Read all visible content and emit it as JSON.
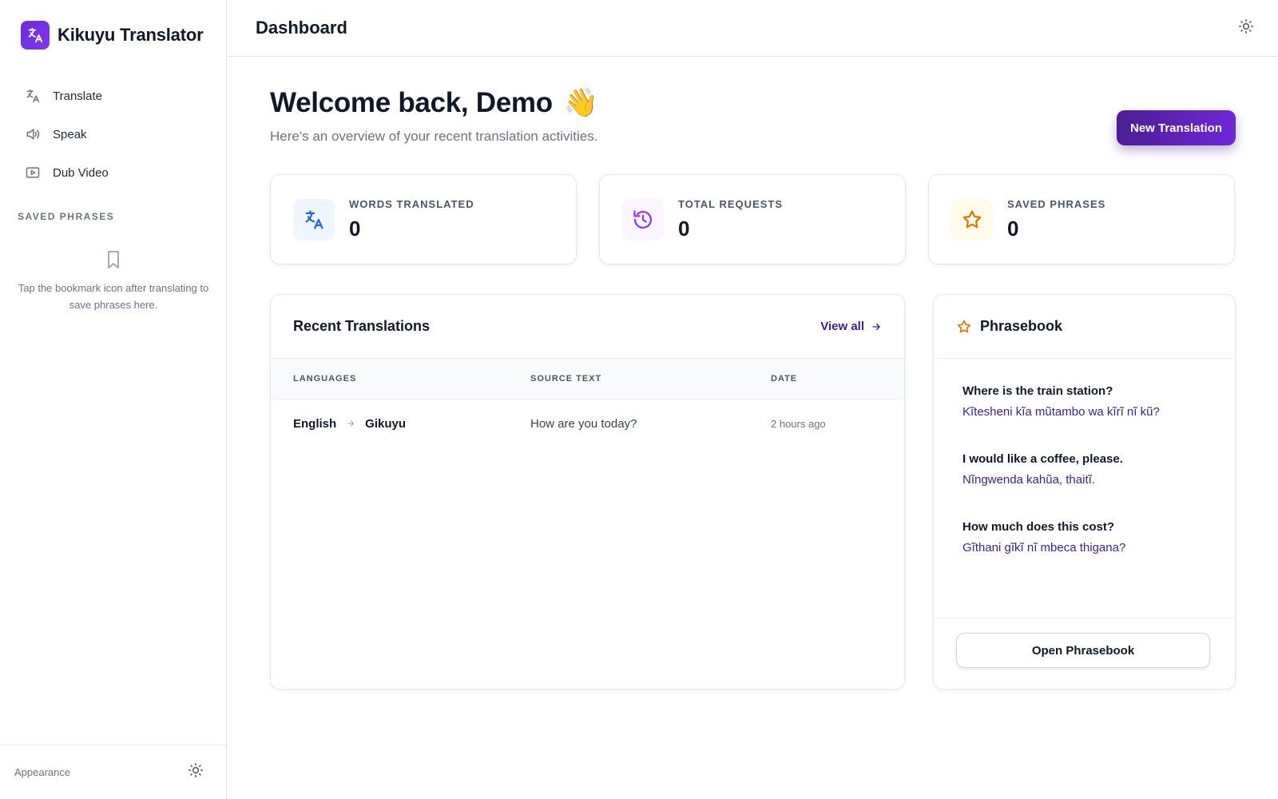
{
  "app": {
    "name": "Kikuyu Translator"
  },
  "sidebar": {
    "nav": [
      {
        "label": "Translate",
        "icon": "translate-icon"
      },
      {
        "label": "Speak",
        "icon": "speaker-icon"
      },
      {
        "label": "Dub Video",
        "icon": "video-icon"
      }
    ],
    "saved_heading": "SAVED PHRASES",
    "saved_empty_text": "Tap the bookmark icon after translating to save phrases here.",
    "footer_label": "Appearance"
  },
  "header": {
    "title": "Dashboard"
  },
  "welcome": {
    "title": "Welcome back, Demo",
    "emoji": "👋",
    "subtitle": "Here's an overview of your recent translation activities."
  },
  "actions": {
    "new_translation": "New Translation"
  },
  "stats": [
    {
      "label": "WORDS TRANSLATED",
      "value": "0",
      "icon": "translate-icon",
      "color": "#2563eb"
    },
    {
      "label": "TOTAL REQUESTS",
      "value": "0",
      "icon": "history-icon",
      "color": "#9333ea"
    },
    {
      "label": "SAVED PHRASES",
      "value": "0",
      "icon": "star-icon",
      "color": "#d97706"
    }
  ],
  "recent": {
    "title": "Recent Translations",
    "view_all": "View all",
    "columns": [
      "LANGUAGES",
      "SOURCE TEXT",
      "DATE"
    ],
    "rows": [
      {
        "from": "English",
        "to": "Gikuyu",
        "source": "How are you today?",
        "date": "2 hours ago"
      }
    ]
  },
  "phrasebook": {
    "title": "Phrasebook",
    "items": [
      {
        "en": "Where is the train station?",
        "ki": "Kĩtesheni kĩa mũtambo wa kĩrĩ nĩ kũ?"
      },
      {
        "en": "I would like a coffee, please.",
        "ki": "Nĩngwenda kahũa, thaitĩ."
      },
      {
        "en": "How much does this cost?",
        "ki": "Gĩthani gĩkĩ nĩ mbeca thigana?"
      }
    ],
    "button": "Open Phrasebook"
  },
  "colors": {
    "accent": "#4c1d95",
    "link": "#3b1f91",
    "border": "#e5e7eb"
  }
}
